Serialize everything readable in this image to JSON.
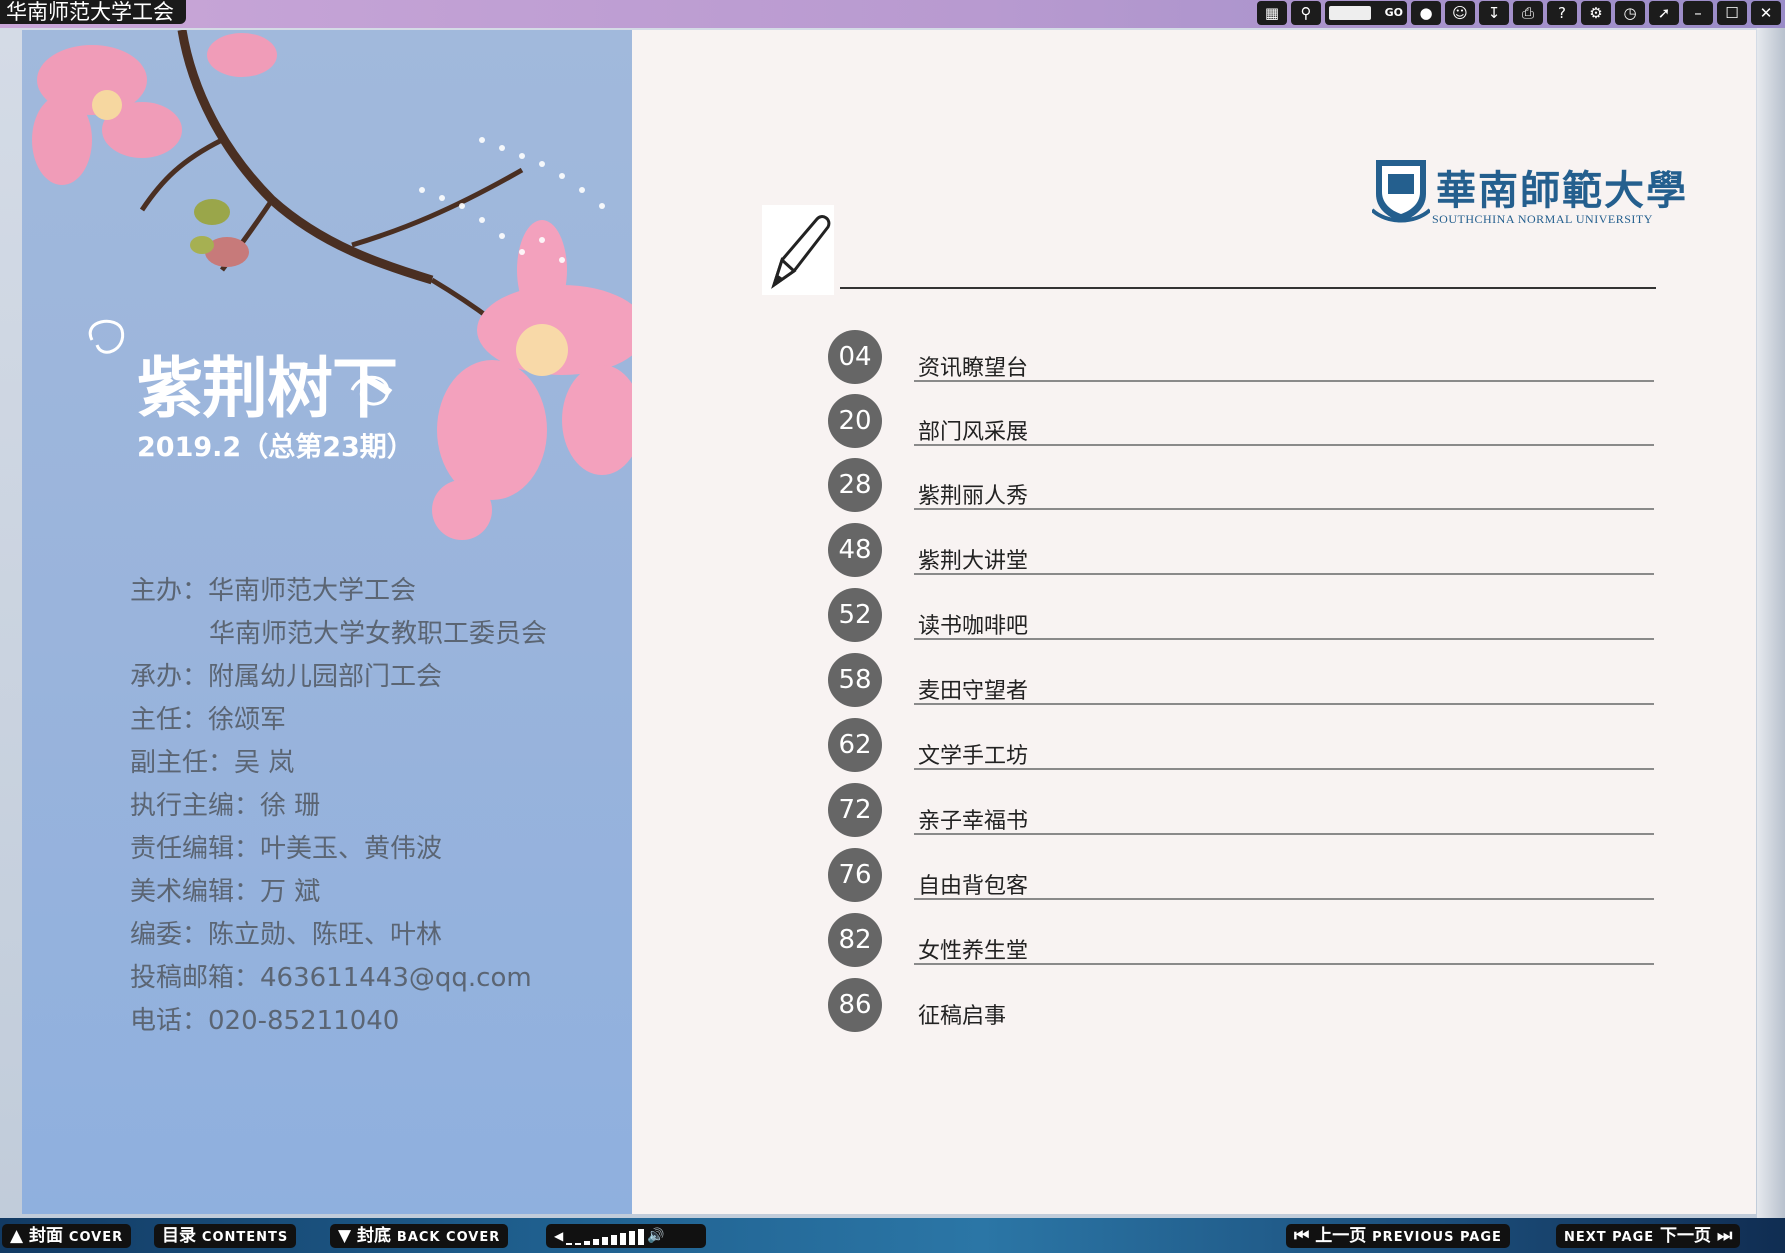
{
  "window": {
    "title": "华南师范大学工会",
    "toolbar_icons": [
      "contents-icon",
      "search-icon",
      "page-input",
      "chat-icon",
      "user-icon",
      "download-icon",
      "print-icon",
      "help-icon",
      "settings-icon",
      "clock-icon",
      "share-icon",
      "minimize-icon",
      "maximize-icon",
      "close-icon"
    ],
    "go_label": "GO"
  },
  "cover": {
    "title": "紫荆树下",
    "issue": "2019.2（总第23期）",
    "credits": [
      "主办：华南师范大学工会",
      "华南师范大学女教职工委员会",
      "承办：附属幼儿园部门工会",
      "主任：徐颂军",
      "副主任：吴 岚",
      "执行主编：徐 珊",
      "责任编辑：叶美玉、黄伟波",
      "美术编辑：万 斌",
      "编委：陈立勋、陈旺、叶林",
      "投稿邮箱：463611443@qq.com",
      "电话：020-85211040"
    ]
  },
  "logo": {
    "name": "華南師範大學",
    "subtitle": "SOUTHCHINA NORMAL UNIVERSITY"
  },
  "toc": [
    {
      "page": "04",
      "title": "资讯瞭望台"
    },
    {
      "page": "20",
      "title": "部门风采展"
    },
    {
      "page": "28",
      "title": "紫荆丽人秀"
    },
    {
      "page": "48",
      "title": "紫荆大讲堂"
    },
    {
      "page": "52",
      "title": "读书咖啡吧"
    },
    {
      "page": "58",
      "title": "麦田守望者"
    },
    {
      "page": "62",
      "title": "文学手工坊"
    },
    {
      "page": "72",
      "title": "亲子幸福书"
    },
    {
      "page": "76",
      "title": "自由背包客"
    },
    {
      "page": "82",
      "title": "女性养生堂"
    },
    {
      "page": "86",
      "title": "征稿启事"
    }
  ],
  "bottom": {
    "cover_cn": "封面",
    "cover_en": "COVER",
    "contents_cn": "目录",
    "contents_en": "CONTENTS",
    "back_cn": "封底",
    "back_en": "BACK COVER",
    "prev_cn": "上一页",
    "prev_en": "PREVIOUS PAGE",
    "next_en": "NEXT PAGE",
    "next_cn": "下一页"
  }
}
